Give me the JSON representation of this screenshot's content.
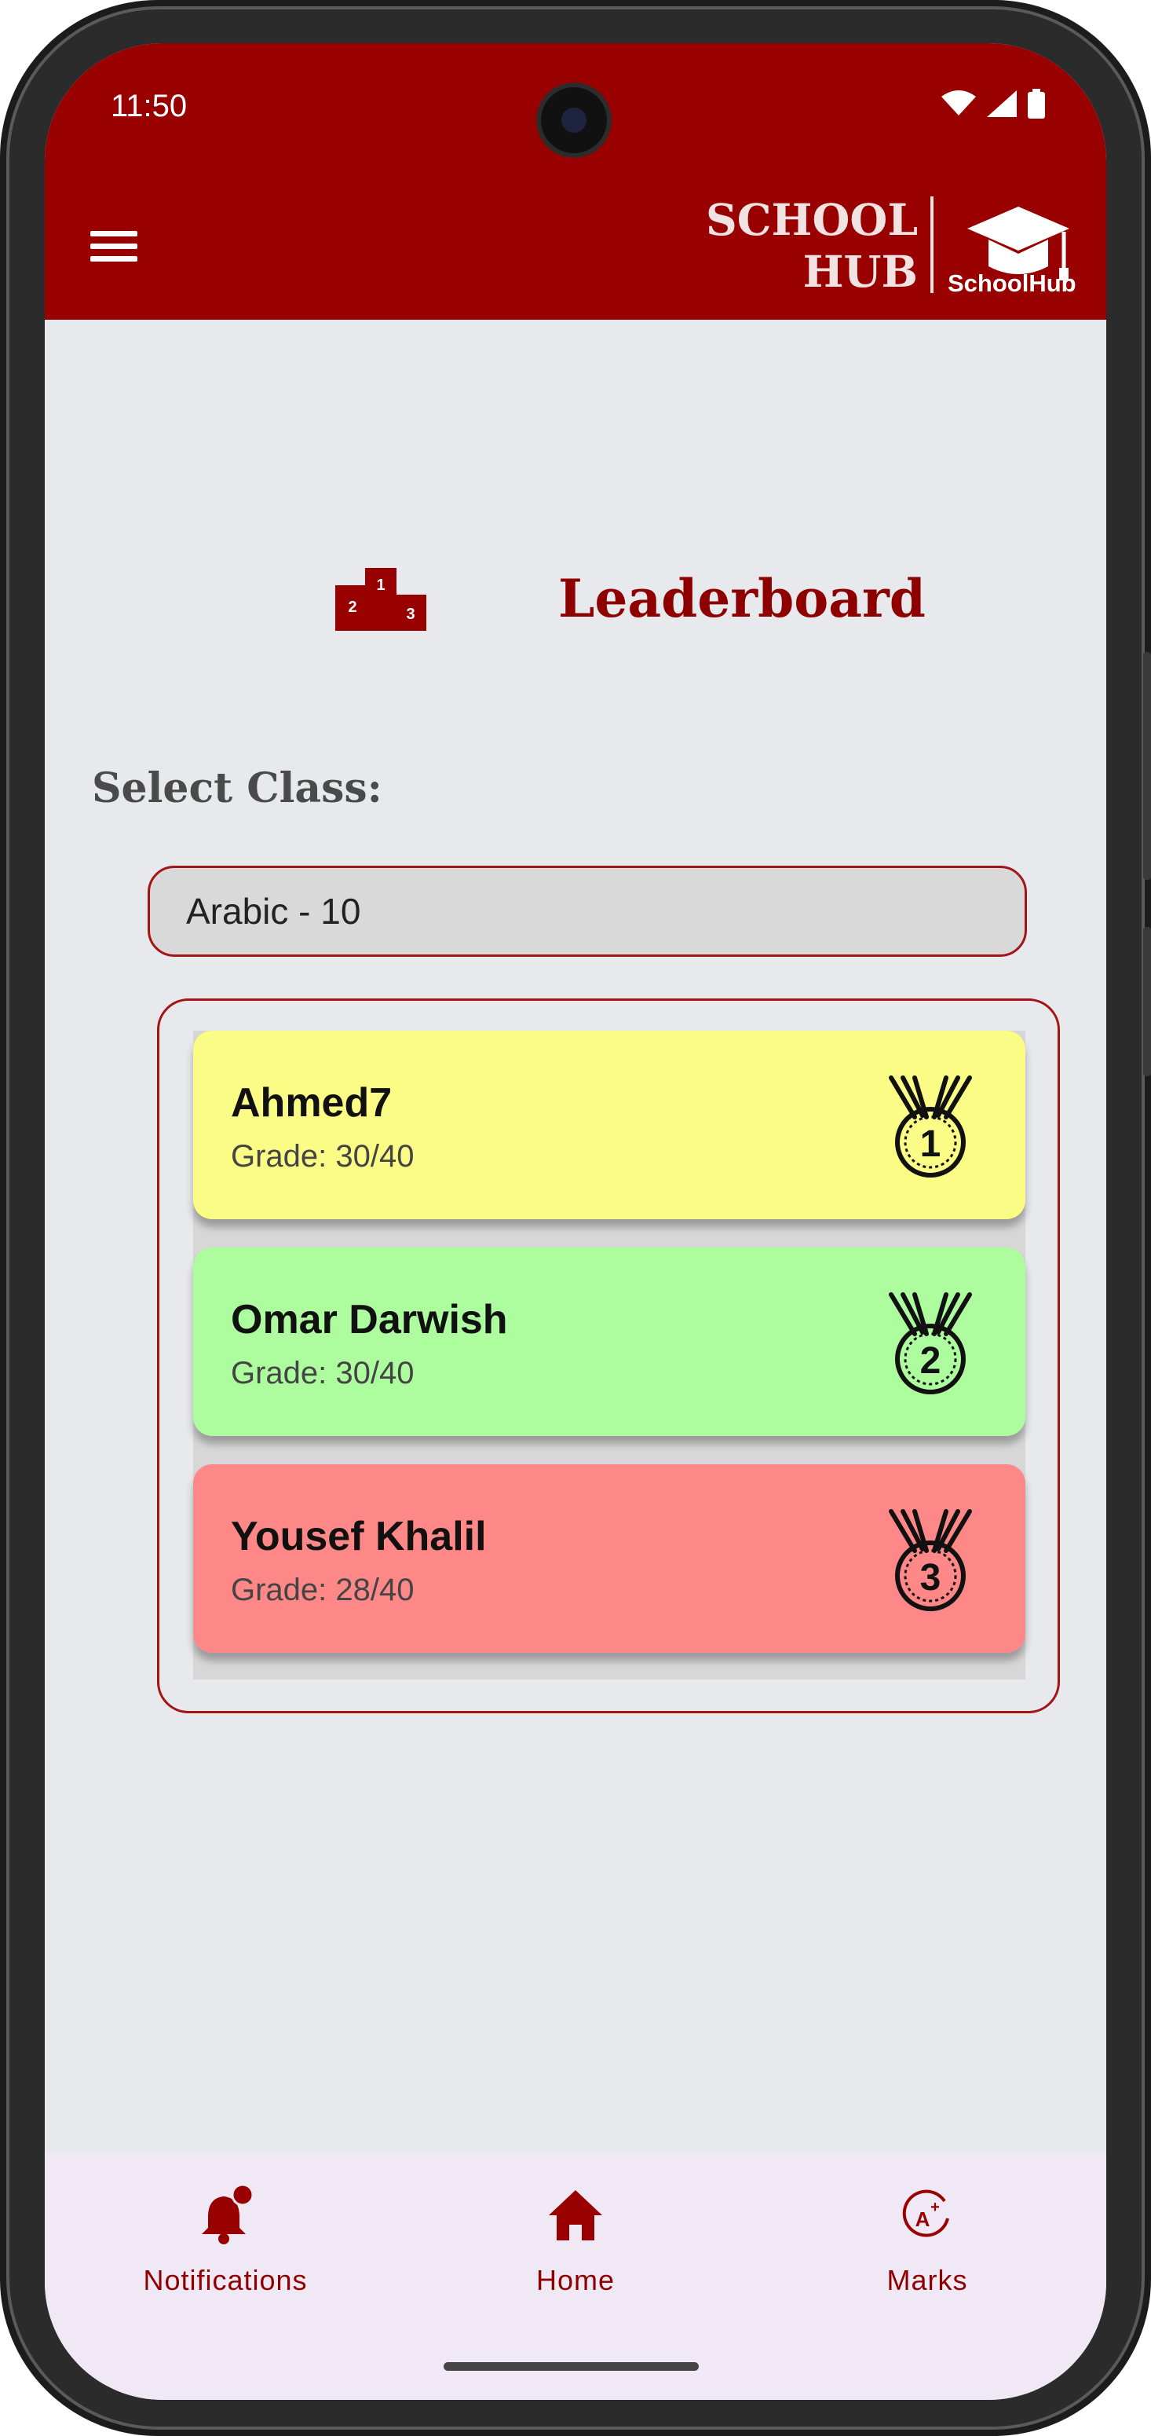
{
  "status_bar": {
    "time": "11:50"
  },
  "header": {
    "brand_line1": "SCHOOL",
    "brand_line2": "HUB",
    "logo_text": "SchoolHub"
  },
  "page": {
    "title": "Leaderboard",
    "select_label": "Select Class:",
    "selected_class": "Arabic - 10"
  },
  "leaderboard": [
    {
      "rank": "1",
      "name": "Ahmed7",
      "grade": "Grade: 30/40",
      "color": "#fbfc85"
    },
    {
      "rank": "2",
      "name": "Omar Darwish",
      "grade": "Grade: 30/40",
      "color": "#adfd9f"
    },
    {
      "rank": "3",
      "name": "Yousef Khalil",
      "grade": "Grade: 28/40",
      "color": "#fe8787"
    }
  ],
  "podium_labels": [
    "2",
    "1",
    "3"
  ],
  "bottom_nav": [
    {
      "label": "Notifications",
      "icon": "bell-icon"
    },
    {
      "label": "Home",
      "icon": "home-icon"
    },
    {
      "label": "Marks",
      "icon": "grade-icon"
    }
  ],
  "colors": {
    "primary": "#990000",
    "background": "#e7e9ec",
    "nav_background": "#f1e8f5"
  }
}
